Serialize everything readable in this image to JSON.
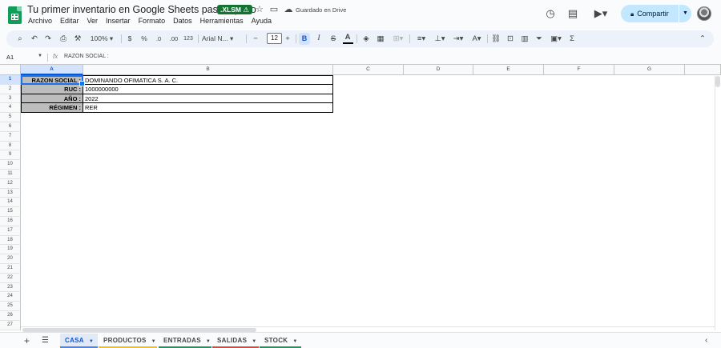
{
  "doc": {
    "title": "Tu primer inventario en Google Sheets paso a paso",
    "badge": ".XLSM ⚠",
    "saved_status": "Guardado en Drive"
  },
  "menu": [
    "Archivo",
    "Editar",
    "Ver",
    "Insertar",
    "Formato",
    "Datos",
    "Herramientas",
    "Ayuda"
  ],
  "header": {
    "share_label": "Compartir",
    "history_icon": "history-icon",
    "comments_icon": "comment-icon",
    "meet_icon": "video-call-icon"
  },
  "toolbar": {
    "zoom": "100%",
    "currency": "$",
    "percent": "%",
    "decrease_decimals": ".0",
    "increase_decimals": ".00",
    "number_format": "123",
    "font": "Arial N...",
    "minus": "−",
    "font_size": "12",
    "plus": "+",
    "bold": "B",
    "italic": "I",
    "strike": "S",
    "text_color": "A"
  },
  "formula_bar": {
    "cell_ref": "A1",
    "fx": "fx",
    "content": "RAZON SOCIAL :"
  },
  "columns": [
    "A",
    "B",
    "C",
    "D",
    "E",
    "F",
    "G"
  ],
  "rows": [
    "1",
    "2",
    "3",
    "4",
    "5",
    "6",
    "7",
    "8",
    "9",
    "10",
    "11",
    "12",
    "13",
    "14",
    "15",
    "16",
    "17",
    "18",
    "19",
    "20",
    "21",
    "22",
    "23",
    "24",
    "25",
    "26",
    "27"
  ],
  "cells": [
    {
      "label": "RAZON SOCIAL :",
      "value": "DOMINANDO OFIMATICA S. A. C."
    },
    {
      "label": "RUC :",
      "value": "1000000000"
    },
    {
      "label": "AÑO :",
      "value": "2022"
    },
    {
      "label": "RÉGIMEN :",
      "value": "RER"
    }
  ],
  "sheets": [
    {
      "name": "CASA",
      "color": "#4285f4",
      "active": true
    },
    {
      "name": "PRODUCTOS",
      "color": "#fbbc04",
      "active": false
    },
    {
      "name": "ENTRADAS",
      "color": "#0f9d58",
      "active": false
    },
    {
      "name": "SALIDAS",
      "color": "#ea4335",
      "active": false
    },
    {
      "name": "STOCK",
      "color": "#0f9d58",
      "active": false
    }
  ]
}
